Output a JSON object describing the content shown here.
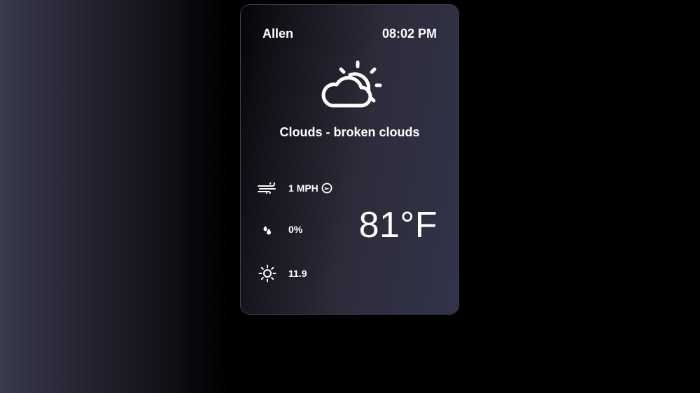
{
  "header": {
    "city": "Allen",
    "time": "08:02 PM"
  },
  "condition": {
    "icon": "partly-cloudy-icon",
    "text": "Clouds - broken clouds"
  },
  "stats": {
    "wind": {
      "icon": "wind-icon",
      "value": "1 MPH",
      "direction_icon": "wind-direction-icon"
    },
    "precipitation": {
      "icon": "raindrops-icon",
      "value": "0%"
    },
    "uv": {
      "icon": "sun-icon",
      "value": "11.9"
    }
  },
  "temperature": "81°F",
  "colors": {
    "text": "#ffffff",
    "card_border": "#3c3c4c",
    "card_gradient_end": "#33334a",
    "page_background": "#000000"
  }
}
